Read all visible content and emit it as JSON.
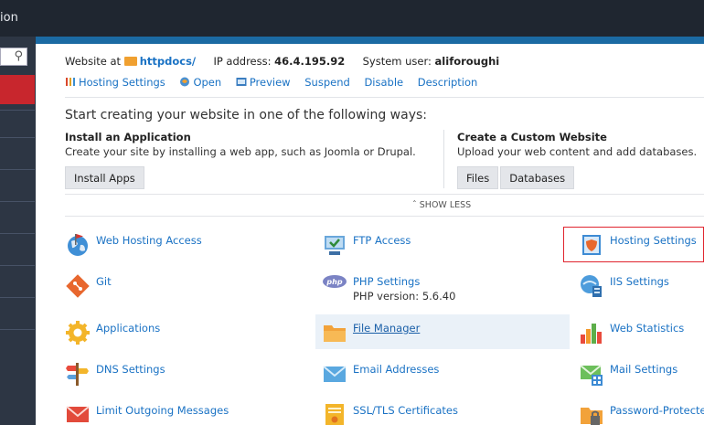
{
  "topbar": {
    "title": "ion"
  },
  "sidebar": {
    "search_icon": "search-icon"
  },
  "website": {
    "label_prefix": "Website at",
    "domain": "httpdocs/",
    "ip_label": "IP address:",
    "ip": "46.4.195.92",
    "user_label": "System user:",
    "user": "aliforoughi"
  },
  "actions": [
    {
      "label": "Hosting Settings",
      "icon": "hosting-settings-icon"
    },
    {
      "label": "Open",
      "icon": "open-icon"
    },
    {
      "label": "Preview",
      "icon": "preview-icon"
    },
    {
      "label": "Suspend"
    },
    {
      "label": "Disable"
    },
    {
      "label": "Description"
    }
  ],
  "start": {
    "heading": "Start creating your website in one of the following ways:",
    "install": {
      "title": "Install an Application",
      "desc": "Create your site by installing a web app, such as Joomla or Drupal.",
      "button": "Install Apps"
    },
    "custom": {
      "title": "Create a Custom Website",
      "desc": "Upload your web content and add databases.",
      "files_button": "Files",
      "databases_button": "Databases"
    }
  },
  "show_less": "SHOW LESS",
  "tools": {
    "web_hosting_access": "Web Hosting Access",
    "ftp_access": "FTP Access",
    "hosting_settings": "Hosting Settings",
    "git": "Git",
    "php_settings": "PHP Settings",
    "php_version": "PHP version: 5.6.40",
    "iis_settings": "IIS Settings",
    "applications": "Applications",
    "file_manager": "File Manager",
    "web_statistics": "Web Statistics",
    "dns_settings": "DNS Settings",
    "email_addresses": "Email Addresses",
    "mail_settings": "Mail Settings",
    "limit_outgoing": "Limit Outgoing Messages",
    "ssl_certificates": "SSL/TLS Certificates",
    "password_protected": "Password-Protected"
  },
  "colors": {
    "link": "#1a72c4",
    "accent_red": "#c8262d",
    "stripe_blue": "#1b6aa3"
  }
}
